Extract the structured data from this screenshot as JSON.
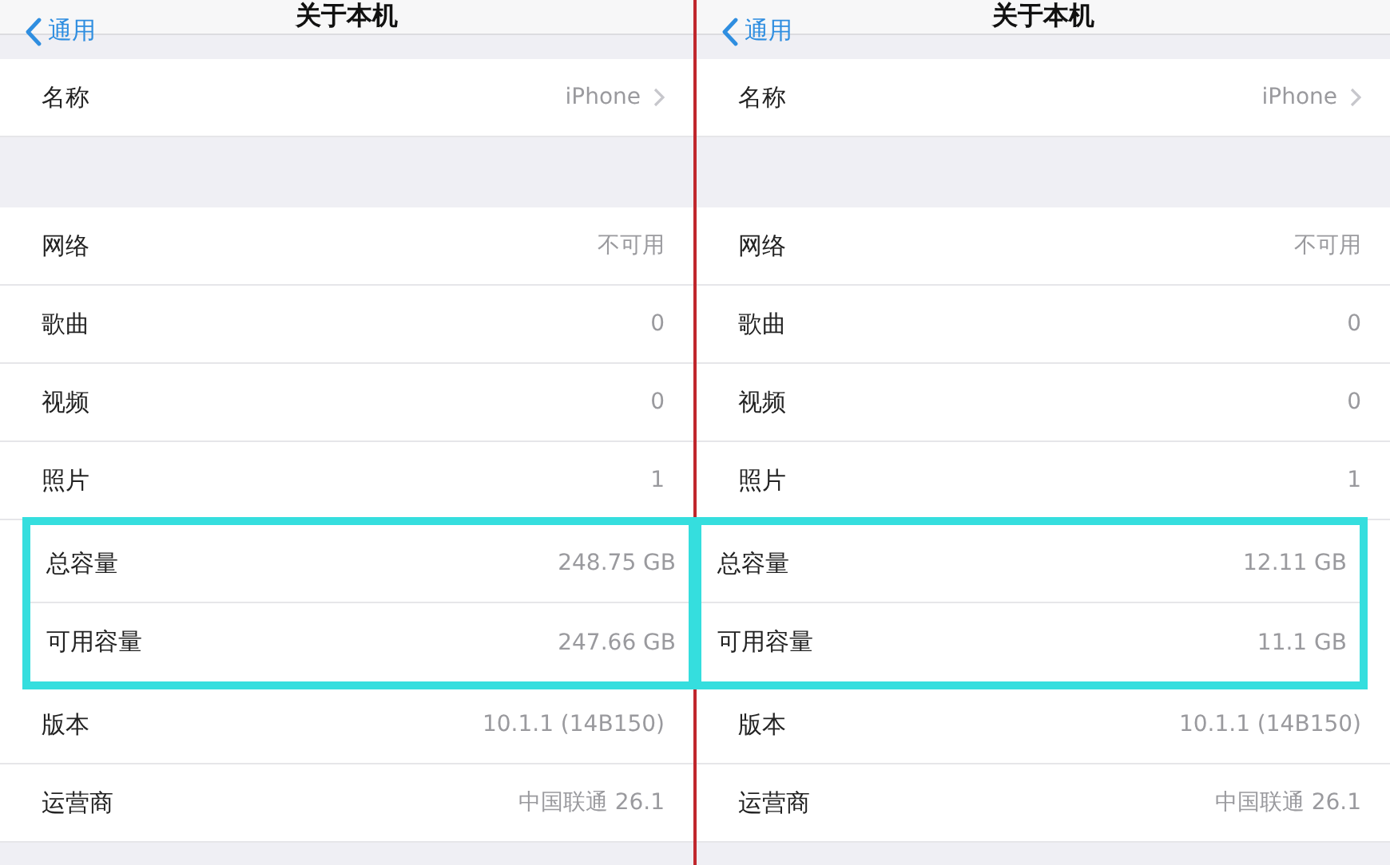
{
  "panels": [
    {
      "back": "通用",
      "title": "关于本机",
      "sections": [
        {
          "rows": [
            {
              "label": "名称",
              "value": "iPhone",
              "chevron": true,
              "highlighted": false
            }
          ]
        },
        {
          "rows": [
            {
              "label": "网络",
              "value": "不可用",
              "chevron": false,
              "highlighted": false
            },
            {
              "label": "歌曲",
              "value": "0",
              "chevron": false,
              "highlighted": false
            },
            {
              "label": "视频",
              "value": "0",
              "chevron": false,
              "highlighted": false
            },
            {
              "label": "照片",
              "value": "1",
              "chevron": false,
              "highlighted": false
            },
            {
              "label": "总容量",
              "value": "248.75 GB",
              "chevron": false,
              "highlighted": true
            },
            {
              "label": "可用容量",
              "value": "247.66 GB",
              "chevron": false,
              "highlighted": true
            },
            {
              "label": "版本",
              "value": "10.1.1 (14B150)",
              "chevron": false,
              "highlighted": false
            },
            {
              "label": "运营商",
              "value": "中国联通 26.1",
              "chevron": false,
              "highlighted": false
            }
          ]
        }
      ]
    },
    {
      "back": "通用",
      "title": "关于本机",
      "sections": [
        {
          "rows": [
            {
              "label": "名称",
              "value": "iPhone",
              "chevron": true,
              "highlighted": false
            }
          ]
        },
        {
          "rows": [
            {
              "label": "网络",
              "value": "不可用",
              "chevron": false,
              "highlighted": false
            },
            {
              "label": "歌曲",
              "value": "0",
              "chevron": false,
              "highlighted": false
            },
            {
              "label": "视频",
              "value": "0",
              "chevron": false,
              "highlighted": false
            },
            {
              "label": "照片",
              "value": "1",
              "chevron": false,
              "highlighted": false
            },
            {
              "label": "总容量",
              "value": "12.11 GB",
              "chevron": false,
              "highlighted": true
            },
            {
              "label": "可用容量",
              "value": "11.1 GB",
              "chevron": false,
              "highlighted": true
            },
            {
              "label": "版本",
              "value": "10.1.1 (14B150)",
              "chevron": false,
              "highlighted": false
            },
            {
              "label": "运营商",
              "value": "中国联通 26.1",
              "chevron": false,
              "highlighted": false
            }
          ]
        }
      ]
    }
  ]
}
